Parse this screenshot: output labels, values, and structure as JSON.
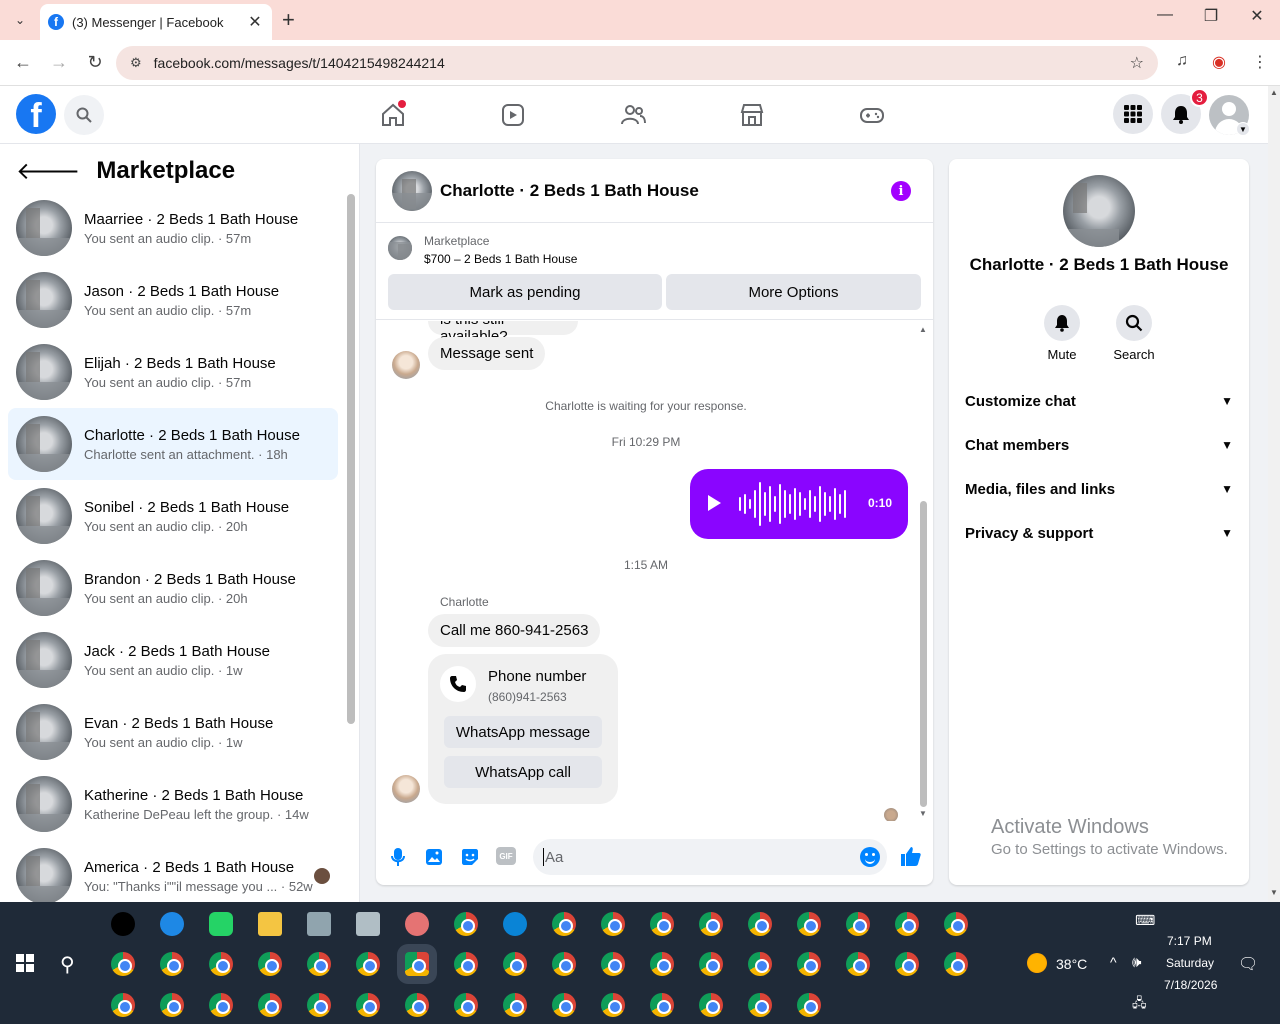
{
  "browser": {
    "tab_title": "(3) Messenger | Facebook",
    "url": "facebook.com/messages/t/1404215498244214",
    "new_tab": "+",
    "close_tab": "✕",
    "window_controls": [
      "—",
      "❐",
      "✕"
    ]
  },
  "fb_header": {
    "logo_letter": "f",
    "notification_count": "3",
    "nav_icons": [
      "home-icon",
      "video-icon",
      "friends-icon",
      "marketplace-icon",
      "gaming-icon"
    ]
  },
  "left_panel": {
    "title": "Marketplace",
    "conversations": [
      {
        "name": "Maarriee · 2 Beds 1 Bath House",
        "preview": "You sent an audio clip. · 57m"
      },
      {
        "name": "Jason · 2 Beds 1 Bath House",
        "preview": "You sent an audio clip. · 57m"
      },
      {
        "name": "Elijah · 2 Beds 1 Bath House",
        "preview": "You sent an audio clip. · 57m"
      },
      {
        "name": "Charlotte · 2 Beds 1 Bath House",
        "preview": "Charlotte sent an attachment. · 18h"
      },
      {
        "name": "Sonibel · 2 Beds 1 Bath House",
        "preview": "You sent an audio clip. · 20h"
      },
      {
        "name": "Brandon · 2 Beds 1 Bath House",
        "preview": "You sent an audio clip. · 20h"
      },
      {
        "name": "Jack · 2 Beds 1 Bath House",
        "preview": "You sent an audio clip. · 1w"
      },
      {
        "name": "Evan · 2 Beds 1 Bath House",
        "preview": "You sent an audio clip. · 1w"
      },
      {
        "name": "Katherine · 2 Beds 1 Bath House",
        "preview": "Katherine DePeau left the group. · 14w"
      },
      {
        "name": "America · 2 Beds 1 Bath House",
        "preview": "You: \"Thanks i\"\"il message you ... · 52w"
      }
    ]
  },
  "chat": {
    "title": "Charlotte · 2 Beds 1 Bath House",
    "marketplace_label": "Marketplace",
    "listing": "$700 – 2 Beds 1 Bath House",
    "mark_pending": "Mark as pending",
    "more_options": "More Options",
    "cut_message": "is this still available?",
    "message_sent": "Message sent",
    "waiting": "Charlotte is waiting for your response.",
    "time1": "Fri 10:29 PM",
    "audio_duration": "0:10",
    "time2": "1:15 AM",
    "sender": "Charlotte",
    "call_me": "Call me 860-941-2563",
    "phone_title": "Phone number",
    "phone_number": "(860)941-2563",
    "whatsapp_message": "WhatsApp message",
    "whatsapp_call": "WhatsApp call",
    "composer_placeholder": "Aa",
    "gif_label": "GIF"
  },
  "right_panel": {
    "name": "Charlotte · 2 Beds 1 Bath House",
    "mute": "Mute",
    "search": "Search",
    "sections": [
      "Customize chat",
      "Chat members",
      "Media, files and links",
      "Privacy & support"
    ]
  },
  "watermark": {
    "line1": "Activate Windows",
    "line2": "Go to Settings to activate Windows."
  },
  "taskbar": {
    "temperature": "38°C",
    "time": "7:17 PM",
    "day": "Saturday",
    "date": "7/18/2026"
  },
  "colors": {
    "facebook_blue": "#1877f2",
    "messenger_purple": "#8a05ff",
    "active_conv_bg": "#ebf5ff",
    "taskbar": "#1f2a38",
    "tabbar": "#fadcd7"
  }
}
